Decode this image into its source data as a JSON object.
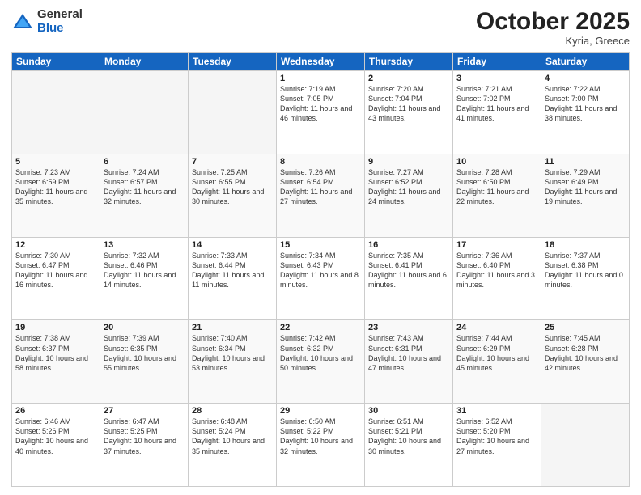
{
  "logo": {
    "general": "General",
    "blue": "Blue"
  },
  "header": {
    "month": "October 2025",
    "location": "Kyria, Greece"
  },
  "days_header": [
    "Sunday",
    "Monday",
    "Tuesday",
    "Wednesday",
    "Thursday",
    "Friday",
    "Saturday"
  ],
  "weeks": [
    [
      {
        "day": "",
        "info": ""
      },
      {
        "day": "",
        "info": ""
      },
      {
        "day": "",
        "info": ""
      },
      {
        "day": "1",
        "info": "Sunrise: 7:19 AM\nSunset: 7:05 PM\nDaylight: 11 hours and 46 minutes."
      },
      {
        "day": "2",
        "info": "Sunrise: 7:20 AM\nSunset: 7:04 PM\nDaylight: 11 hours and 43 minutes."
      },
      {
        "day": "3",
        "info": "Sunrise: 7:21 AM\nSunset: 7:02 PM\nDaylight: 11 hours and 41 minutes."
      },
      {
        "day": "4",
        "info": "Sunrise: 7:22 AM\nSunset: 7:00 PM\nDaylight: 11 hours and 38 minutes."
      }
    ],
    [
      {
        "day": "5",
        "info": "Sunrise: 7:23 AM\nSunset: 6:59 PM\nDaylight: 11 hours and 35 minutes."
      },
      {
        "day": "6",
        "info": "Sunrise: 7:24 AM\nSunset: 6:57 PM\nDaylight: 11 hours and 32 minutes."
      },
      {
        "day": "7",
        "info": "Sunrise: 7:25 AM\nSunset: 6:55 PM\nDaylight: 11 hours and 30 minutes."
      },
      {
        "day": "8",
        "info": "Sunrise: 7:26 AM\nSunset: 6:54 PM\nDaylight: 11 hours and 27 minutes."
      },
      {
        "day": "9",
        "info": "Sunrise: 7:27 AM\nSunset: 6:52 PM\nDaylight: 11 hours and 24 minutes."
      },
      {
        "day": "10",
        "info": "Sunrise: 7:28 AM\nSunset: 6:50 PM\nDaylight: 11 hours and 22 minutes."
      },
      {
        "day": "11",
        "info": "Sunrise: 7:29 AM\nSunset: 6:49 PM\nDaylight: 11 hours and 19 minutes."
      }
    ],
    [
      {
        "day": "12",
        "info": "Sunrise: 7:30 AM\nSunset: 6:47 PM\nDaylight: 11 hours and 16 minutes."
      },
      {
        "day": "13",
        "info": "Sunrise: 7:32 AM\nSunset: 6:46 PM\nDaylight: 11 hours and 14 minutes."
      },
      {
        "day": "14",
        "info": "Sunrise: 7:33 AM\nSunset: 6:44 PM\nDaylight: 11 hours and 11 minutes."
      },
      {
        "day": "15",
        "info": "Sunrise: 7:34 AM\nSunset: 6:43 PM\nDaylight: 11 hours and 8 minutes."
      },
      {
        "day": "16",
        "info": "Sunrise: 7:35 AM\nSunset: 6:41 PM\nDaylight: 11 hours and 6 minutes."
      },
      {
        "day": "17",
        "info": "Sunrise: 7:36 AM\nSunset: 6:40 PM\nDaylight: 11 hours and 3 minutes."
      },
      {
        "day": "18",
        "info": "Sunrise: 7:37 AM\nSunset: 6:38 PM\nDaylight: 11 hours and 0 minutes."
      }
    ],
    [
      {
        "day": "19",
        "info": "Sunrise: 7:38 AM\nSunset: 6:37 PM\nDaylight: 10 hours and 58 minutes."
      },
      {
        "day": "20",
        "info": "Sunrise: 7:39 AM\nSunset: 6:35 PM\nDaylight: 10 hours and 55 minutes."
      },
      {
        "day": "21",
        "info": "Sunrise: 7:40 AM\nSunset: 6:34 PM\nDaylight: 10 hours and 53 minutes."
      },
      {
        "day": "22",
        "info": "Sunrise: 7:42 AM\nSunset: 6:32 PM\nDaylight: 10 hours and 50 minutes."
      },
      {
        "day": "23",
        "info": "Sunrise: 7:43 AM\nSunset: 6:31 PM\nDaylight: 10 hours and 47 minutes."
      },
      {
        "day": "24",
        "info": "Sunrise: 7:44 AM\nSunset: 6:29 PM\nDaylight: 10 hours and 45 minutes."
      },
      {
        "day": "25",
        "info": "Sunrise: 7:45 AM\nSunset: 6:28 PM\nDaylight: 10 hours and 42 minutes."
      }
    ],
    [
      {
        "day": "26",
        "info": "Sunrise: 6:46 AM\nSunset: 5:26 PM\nDaylight: 10 hours and 40 minutes."
      },
      {
        "day": "27",
        "info": "Sunrise: 6:47 AM\nSunset: 5:25 PM\nDaylight: 10 hours and 37 minutes."
      },
      {
        "day": "28",
        "info": "Sunrise: 6:48 AM\nSunset: 5:24 PM\nDaylight: 10 hours and 35 minutes."
      },
      {
        "day": "29",
        "info": "Sunrise: 6:50 AM\nSunset: 5:22 PM\nDaylight: 10 hours and 32 minutes."
      },
      {
        "day": "30",
        "info": "Sunrise: 6:51 AM\nSunset: 5:21 PM\nDaylight: 10 hours and 30 minutes."
      },
      {
        "day": "31",
        "info": "Sunrise: 6:52 AM\nSunset: 5:20 PM\nDaylight: 10 hours and 27 minutes."
      },
      {
        "day": "",
        "info": ""
      }
    ]
  ]
}
